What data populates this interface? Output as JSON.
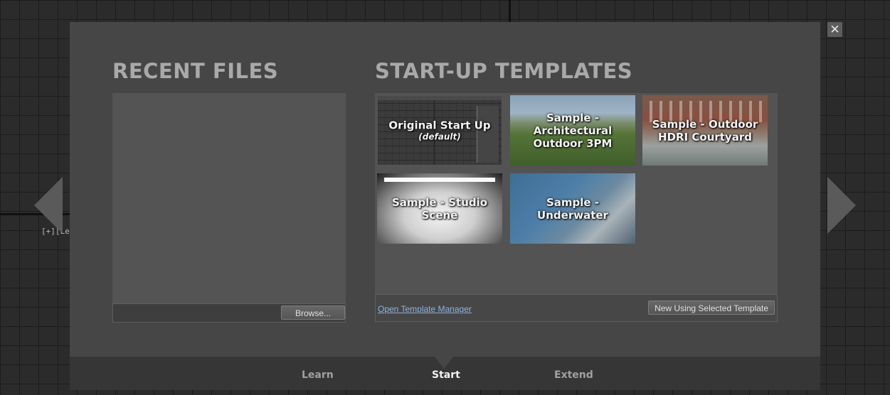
{
  "viewport": {
    "label": "[+][Le"
  },
  "dialog": {
    "recent_files": {
      "title": "RECENT FILES",
      "browse_label": "Browse..."
    },
    "templates": {
      "title": "START-UP TEMPLATES",
      "items": [
        {
          "label": "Original Start Up",
          "sublabel": "(default)"
        },
        {
          "label": "Sample - Architectural Outdoor 3PM"
        },
        {
          "label": "Sample - Outdoor HDRI Courtyard"
        },
        {
          "label": "Sample - Studio Scene"
        },
        {
          "label": "Sample - Underwater"
        }
      ],
      "manager_link": "Open Template Manager",
      "new_button": "New Using Selected Template"
    },
    "close_label": "✕",
    "tabs": [
      {
        "label": "Learn",
        "active": false
      },
      {
        "label": "Start",
        "active": true
      },
      {
        "label": "Extend",
        "active": false
      }
    ]
  },
  "icons": {
    "close": "close-icon",
    "prev": "chevron-left-icon",
    "next": "chevron-right-icon"
  },
  "colors": {
    "dialog_bg": "#464646",
    "link": "#8fb3e0",
    "title": "#a9a9a9"
  }
}
